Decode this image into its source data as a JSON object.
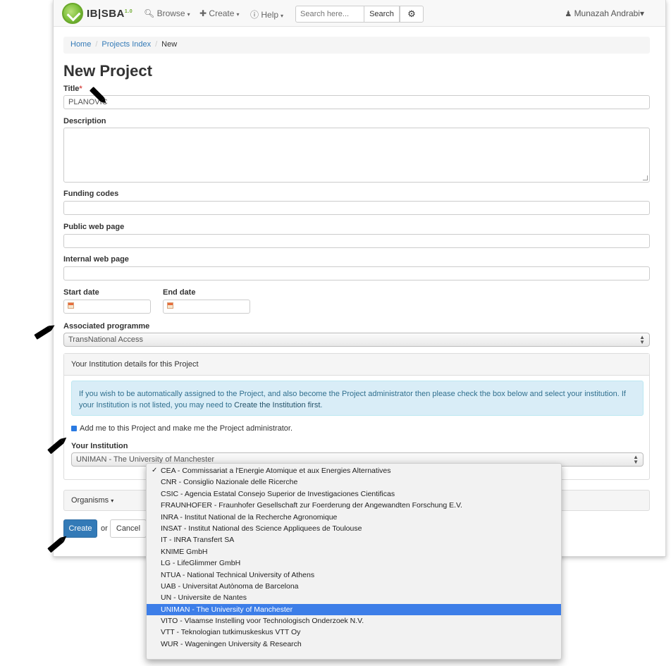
{
  "navbar": {
    "logo_text": "IB|SBA",
    "logo_sup": "1.0",
    "browse_label": "Browse",
    "create_label": "Create",
    "help_label": "Help",
    "search_placeholder": "Search here...",
    "search_button": "Search",
    "user_name": "Munazah Andrabi"
  },
  "breadcrumb": {
    "home": "Home",
    "projects_index": "Projects Index",
    "current": "New"
  },
  "page_title": "New Project",
  "form": {
    "title_label": "Title",
    "title_required_mark": "*",
    "title_value": "PLANOVIC",
    "description_label": "Description",
    "description_value": "",
    "funding_codes_label": "Funding codes",
    "public_web_page_label": "Public web page",
    "internal_web_page_label": "Internal web page",
    "start_date_label": "Start date",
    "end_date_label": "End date",
    "associated_programme_label": "Associated programme",
    "associated_programme_value": "TransNational Access"
  },
  "institution_panel": {
    "heading": "Your Institution details for this Project",
    "info_text_1": "If you wish to be automatically assigned to the Project, and also become the Project administrator then please check the box below and select your institution. If your Institution is not listed, you may need to ",
    "info_link": "Create the Institution first",
    "info_text_2": ".",
    "add_me_label": "Add me to this Project and make me the Project administrator.",
    "add_me_checked": true,
    "your_institution_label": "Your Institution",
    "selected_institution": "UNIMAN - The University of Manchester"
  },
  "organisms_label": "Organisms",
  "buttons": {
    "create": "Create",
    "or": "or",
    "cancel": "Cancel"
  },
  "institution_options": [
    "CEA - Commissariat a l'Energie Atomique et aux Energies Alternatives",
    "CNR - Consiglio Nazionale delle Ricerche",
    "CSIC - Agencia Estatal Consejo Superior de Investigaciones Cientificas",
    "FRAUNHOFER - Fraunhofer Gesellschaft zur Foerderung der Angewandten Forschung E.V.",
    "INRA - Institut National de la Recherche Agronomique",
    "INSAT - Institut National des Science Appliquees de Toulouse",
    "IT - INRA Transfert SA",
    "KNIME GmbH",
    "LG - LifeGlimmer GmbH",
    "NTUA - National Technical University of Athens",
    "UAB - Universitat Autònoma de Barcelona",
    "UN - Universite de Nantes",
    "UNIMAN - The University of Manchester",
    "VITO - Vlaamse Instelling voor Technologisch Onderzoek N.V.",
    "VTT - Teknologian tutkimuskeskus VTT Oy",
    "WUR - Wageningen University & Research"
  ],
  "checked_option_index": 0,
  "highlighted_option_index": 12
}
